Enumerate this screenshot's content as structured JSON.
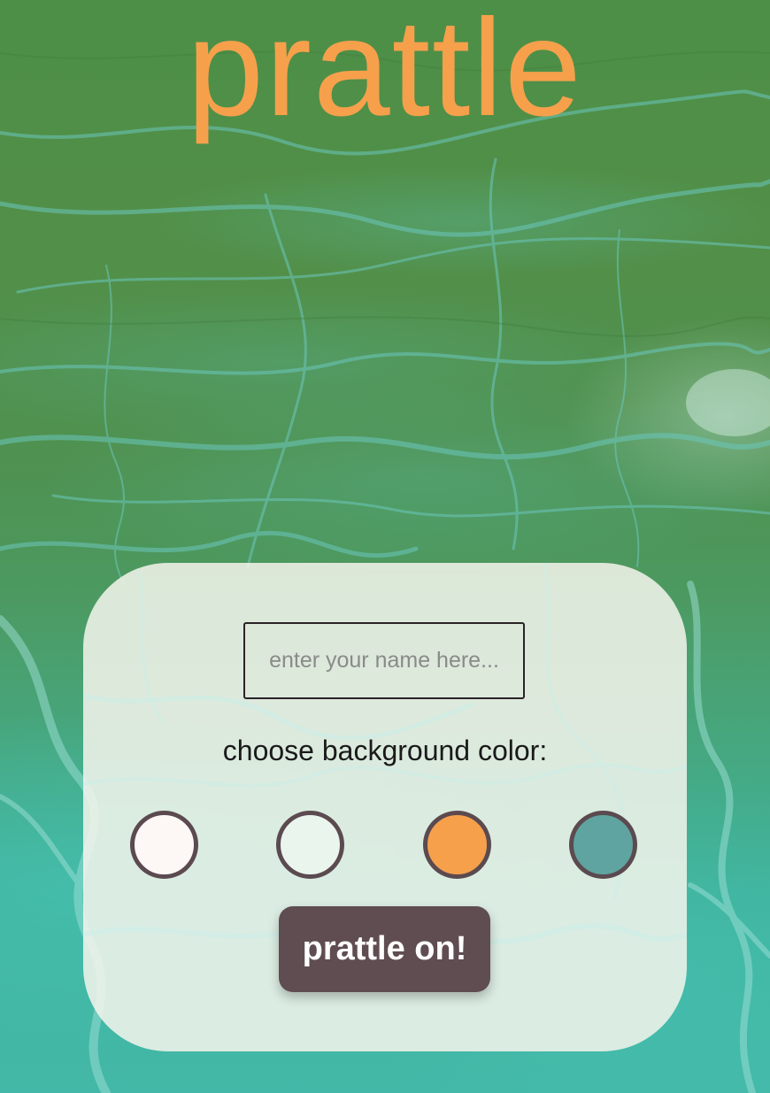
{
  "app": {
    "title": "prattle",
    "title_color": "#f6a04c"
  },
  "start_form": {
    "name_input": {
      "value": "",
      "placeholder": "enter your name here..."
    },
    "color_label": "choose background color:",
    "color_options": [
      {
        "color": "#fdf8f6"
      },
      {
        "color": "#eaf5ee"
      },
      {
        "color": "#f6a04c"
      },
      {
        "color": "#5fa4a0"
      }
    ],
    "swatch_border_color": "#5b4a4f",
    "submit_label": "prattle on!",
    "submit_color": "#5f4d52"
  }
}
